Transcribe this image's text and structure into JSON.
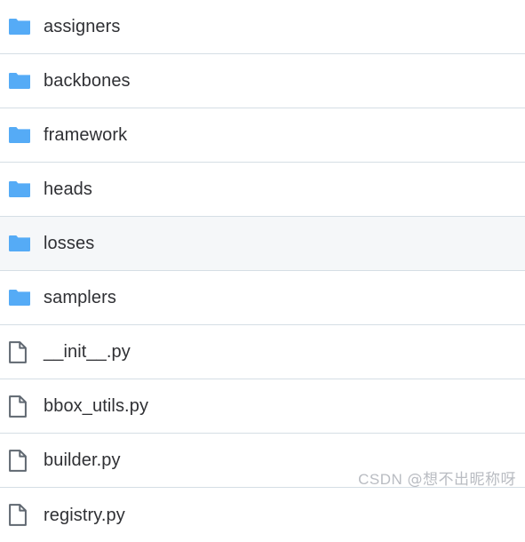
{
  "colors": {
    "background": "#ffffff",
    "row_divider": "#d5dee5",
    "selected_row": "#f5f7f9",
    "folder_icon": "#55abf6",
    "file_icon_stroke": "#5f6770",
    "label_text": "#2f3034",
    "watermark_text": "#b9bcc2"
  },
  "file_list": {
    "rows": [
      {
        "name": "assigners",
        "type": "folder",
        "icon": "folder-icon",
        "selected": false
      },
      {
        "name": "backbones",
        "type": "folder",
        "icon": "folder-icon",
        "selected": false
      },
      {
        "name": "framework",
        "type": "folder",
        "icon": "folder-icon",
        "selected": false
      },
      {
        "name": "heads",
        "type": "folder",
        "icon": "folder-icon",
        "selected": false
      },
      {
        "name": "losses",
        "type": "folder",
        "icon": "folder-icon",
        "selected": true
      },
      {
        "name": "samplers",
        "type": "folder",
        "icon": "folder-icon",
        "selected": false
      },
      {
        "name": "__init__.py",
        "type": "file",
        "icon": "document-icon",
        "selected": false
      },
      {
        "name": "bbox_utils.py",
        "type": "file",
        "icon": "document-icon",
        "selected": false
      },
      {
        "name": "builder.py",
        "type": "file",
        "icon": "document-icon",
        "selected": false
      },
      {
        "name": "registry.py",
        "type": "file",
        "icon": "document-icon",
        "selected": false
      }
    ]
  },
  "watermark": {
    "prefix": "CSDN ",
    "handle": "@想不出昵称呀"
  }
}
